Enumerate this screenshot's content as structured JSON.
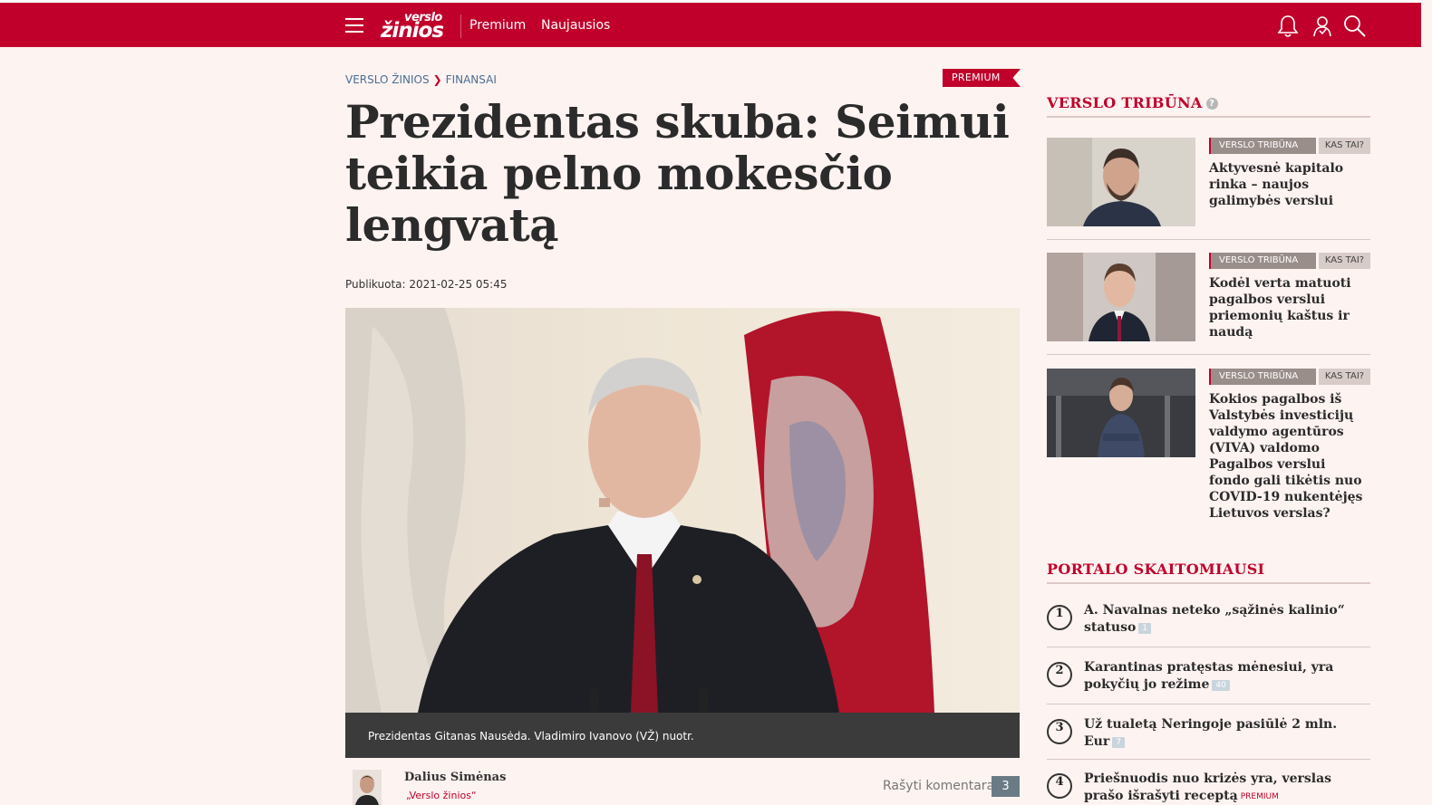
{
  "header": {
    "logo_top": "verslo",
    "logo_bottom": "žinios",
    "nav": [
      "Premium",
      "Naujausios"
    ],
    "icons": [
      "bell-icon",
      "user-icon",
      "search-icon"
    ]
  },
  "article": {
    "breadcrumb": [
      "VERSLO ŽINIOS",
      "FINANSAI"
    ],
    "badge": "PREMIUM",
    "title": "Prezidentas skuba: Seimui teikia pelno mokesčio lengvatą",
    "published": "Publikuota: 2021-02-25 05:45",
    "caption": "Prezidentas Gitanas Nausėda. Vladimiro Ivanovo (VŽ) nuotr.",
    "author_name": "Dalius Simėnas",
    "author_org": "„Verslo žinios“",
    "comment_link": "Rašyti komentarą",
    "comment_count": "3"
  },
  "tribuna": {
    "title": "VERSLO TRIBŪNA",
    "help": "?",
    "items": [
      {
        "tag": "VERSLO TRIBŪNA",
        "kas": "KAS TAI?",
        "title": "Aktyvesnė kapitalo rinka – naujos galimybės verslui"
      },
      {
        "tag": "VERSLO TRIBŪNA",
        "kas": "KAS TAI?",
        "title": "Kodėl verta matuoti pagalbos verslui priemonių kaštus ir naudą"
      },
      {
        "tag": "VERSLO TRIBŪNA",
        "kas": "KAS TAI?",
        "title": "Kokios pagalbos iš Valstybės investicijų valdymo agentūros (VIVA) valdomo Pagalbos verslui fondo gali tikėtis nuo COVID-19 nukentėjęs Lietuvos verslas?"
      }
    ]
  },
  "popular": {
    "title": "PORTALO SKAITOMIAUSI",
    "items": [
      {
        "num": "1",
        "title": "A. Navalnas neteko „sąžinės kalinio“ statuso",
        "count": "1",
        "premium": ""
      },
      {
        "num": "2",
        "title": "Karantinas pratęstas mėnesiui, yra pokyčių jo režime",
        "count": "40",
        "premium": ""
      },
      {
        "num": "3",
        "title": "Už tualetą Neringoje pasiūlė 2 mln. Eur",
        "count": "7",
        "premium": ""
      },
      {
        "num": "4",
        "title": "Priešnuodis nuo krizės yra, verslas prašo išrašyti receptą",
        "count": "",
        "premium": "PREMIUM"
      }
    ]
  },
  "colors": {
    "brand": "#c0002b",
    "background": "#fdf3f1"
  }
}
